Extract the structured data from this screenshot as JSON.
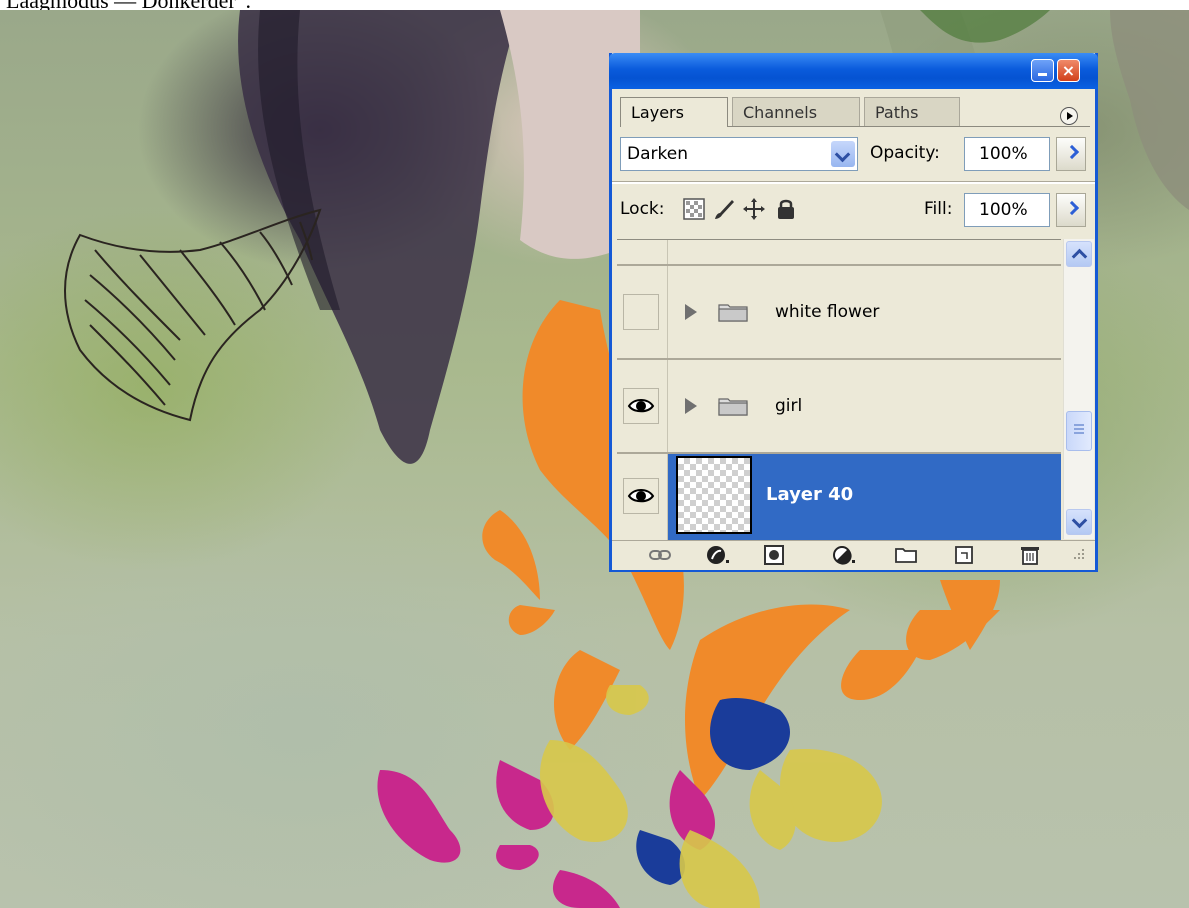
{
  "caption": {
    "text": "Laagmodus — Donkerder”."
  },
  "canvas": {
    "description": ""
  },
  "panel": {
    "title": "",
    "tabs": [
      {
        "label": "Layers",
        "active": true
      },
      {
        "label": "Channels",
        "active": false
      },
      {
        "label": "Paths",
        "active": false
      }
    ],
    "blend_mode": "Darken",
    "opacity_label": "Opacity:",
    "opacity_value": "100%",
    "lock_label": "Lock:",
    "fill_label": "Fill:",
    "fill_value": "100%",
    "layers": [
      {
        "name": "white flower",
        "type": "group",
        "visible": false
      },
      {
        "name": "girl",
        "type": "group",
        "visible": true
      },
      {
        "name": "Layer 40",
        "type": "layer",
        "visible": true,
        "selected": true
      }
    ],
    "icons": {
      "minimize": "minimize-icon",
      "close": "close-icon",
      "panel_menu": "panel-menu-icon",
      "lock_transparent": "lock-transparency-icon",
      "lock_image": "lock-image-icon",
      "lock_position": "lock-position-icon",
      "lock_all": "lock-all-icon",
      "link": "link-layers-icon",
      "styles": "layer-style-icon",
      "mask": "layer-mask-icon",
      "adjust": "adjustment-layer-icon",
      "group": "new-group-icon",
      "new_layer": "new-layer-icon",
      "trash": "delete-layer-icon"
    },
    "colors": {
      "title_blue": "#0a5bdc",
      "selection": "#316ac5",
      "panel_bg": "#ece9d8"
    }
  }
}
